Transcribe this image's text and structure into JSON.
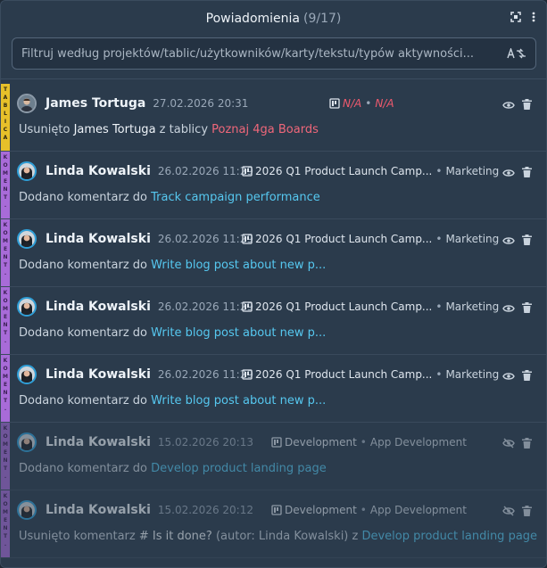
{
  "header": {
    "title": "Powiadomienia",
    "count": "(9/17)"
  },
  "filter": {
    "placeholder": "Filtruj według projektów/tablic/użytkowników/karty/tekstu/typów aktywności..."
  },
  "colors": {
    "board_stripe": "#e6c02a",
    "comment_stripe": "#a86bd8",
    "link": "#56c8f0",
    "link_red": "#f0677a",
    "na_red": "#f05a6e"
  },
  "notifications": [
    {
      "stripe": "TABLICA",
      "user": "James Tortuga",
      "date": "27.02.2026 20:31",
      "board": "N/A",
      "project": "N/A",
      "text_before": "Usunięto",
      "text_strong": "James Tortuga",
      "text_mid": "z tablicy",
      "link": "Poznaj 4ga Boards"
    },
    {
      "stripe": "KOMENT.",
      "user": "Linda Kowalski",
      "date": "26.02.2026 11:29",
      "board": "2026 Q1 Product Launch Camp...",
      "project": "Marketing",
      "text_before": "Dodano komentarz do",
      "link": "Track campaign performance"
    },
    {
      "stripe": "KOMENT.",
      "user": "Linda Kowalski",
      "date": "26.02.2026 11:29",
      "board": "2026 Q1 Product Launch Camp...",
      "project": "Marketing",
      "text_before": "Dodano komentarz do",
      "link": "Write blog post about new p..."
    },
    {
      "stripe": "KOMENT.",
      "user": "Linda Kowalski",
      "date": "26.02.2026 11:29",
      "board": "2026 Q1 Product Launch Camp...",
      "project": "Marketing",
      "text_before": "Dodano komentarz do",
      "link": "Write blog post about new p..."
    },
    {
      "stripe": "KOMENT.",
      "user": "Linda Kowalski",
      "date": "26.02.2026 11:29",
      "board": "2026 Q1 Product Launch Camp...",
      "project": "Marketing",
      "text_before": "Dodano komentarz do",
      "link": "Write blog post about new p..."
    },
    {
      "stripe": "KOMENT.",
      "user": "Linda Kowalski",
      "date": "15.02.2026 20:13",
      "board": "Development",
      "project": "App Development",
      "text_before": "Dodano komentarz do",
      "link": "Develop product landing page"
    },
    {
      "stripe": "KOMENT.",
      "user": "Linda Kowalski",
      "date": "15.02.2026 20:12",
      "board": "Development",
      "project": "App Development",
      "text_before": "Usunięto komentarz",
      "text_strong": "# Is it done?",
      "text_mid": "(autor: Linda Kowalski) z",
      "link": "Develop product landing page"
    }
  ]
}
